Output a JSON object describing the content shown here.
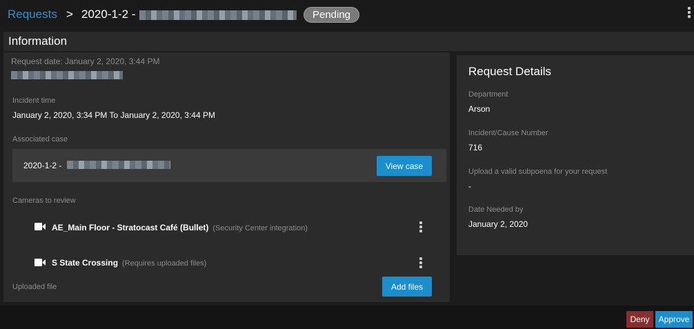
{
  "header": {
    "breadcrumb_root": "Requests",
    "breadcrumb_separator": ">",
    "request_title": "2020-1-2 -",
    "status_badge": "Pending"
  },
  "info": {
    "title": "Information",
    "request_date": "Request date:  January 2, 2020, 3:44 PM",
    "incident_time_label": "Incident time",
    "incident_time_value": "January 2, 2020, 3:34 PM To January 2, 2020, 3:44 PM",
    "associated_case_label": "Associated case",
    "associated_case_value": "2020-1-2 -",
    "view_case_button": "View case",
    "cameras_label": "Cameras to review",
    "cameras": [
      {
        "name": "AE_Main Floor - Stratocast Café (Bullet)",
        "note": "(Security Center integration)",
        "icon": "video-camera-icon"
      },
      {
        "name": "S State Crossing",
        "note": "(Requires uploaded files)",
        "icon": "video-camera-icon"
      }
    ],
    "uploaded_file_label": "Uploaded file",
    "add_files_button": "Add files"
  },
  "request_details": {
    "title": "Request Details",
    "fields": [
      {
        "label": "Department",
        "value": "Arson"
      },
      {
        "label": "Incident/Cause Number",
        "value": "716"
      },
      {
        "label": "Upload a valid subpoena for your request",
        "value": "-"
      },
      {
        "label": "Date Needed by",
        "value": "January 2, 2020"
      }
    ]
  },
  "footer": {
    "deny_button": "Deny",
    "approve_button": "Approve"
  },
  "colors": {
    "accent": "#1b8fce",
    "link": "#2f8fd1",
    "deny": "#8b2e2e",
    "badge": "#7a7a7a",
    "panel": "#2b2b2b",
    "background": "#1c1c1c"
  }
}
